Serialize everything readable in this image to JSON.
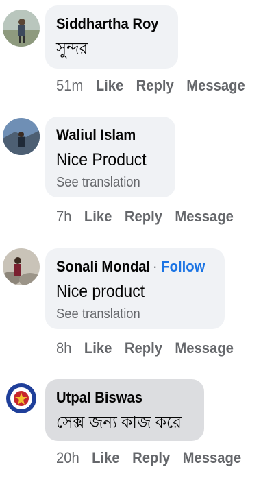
{
  "comments": [
    {
      "name": "Siddhartha Roy",
      "text": "সুন্দর",
      "time": "51m",
      "like": "Like",
      "reply": "Reply",
      "message": "Message"
    },
    {
      "name": "Waliul Islam",
      "text": "Nice Product",
      "translation": "See translation",
      "time": "7h",
      "like": "Like",
      "reply": "Reply",
      "message": "Message"
    },
    {
      "name": "Sonali Mondal",
      "follow_separator": "·",
      "follow": "Follow",
      "text": "Nice product",
      "translation": "See translation",
      "time": "8h",
      "like": "Like",
      "reply": "Reply",
      "message": "Message"
    },
    {
      "name": "Utpal Biswas",
      "text": "সেক্স জন্য কাজ করে",
      "time": "20h",
      "like": "Like",
      "reply": "Reply",
      "message": "Message"
    }
  ]
}
